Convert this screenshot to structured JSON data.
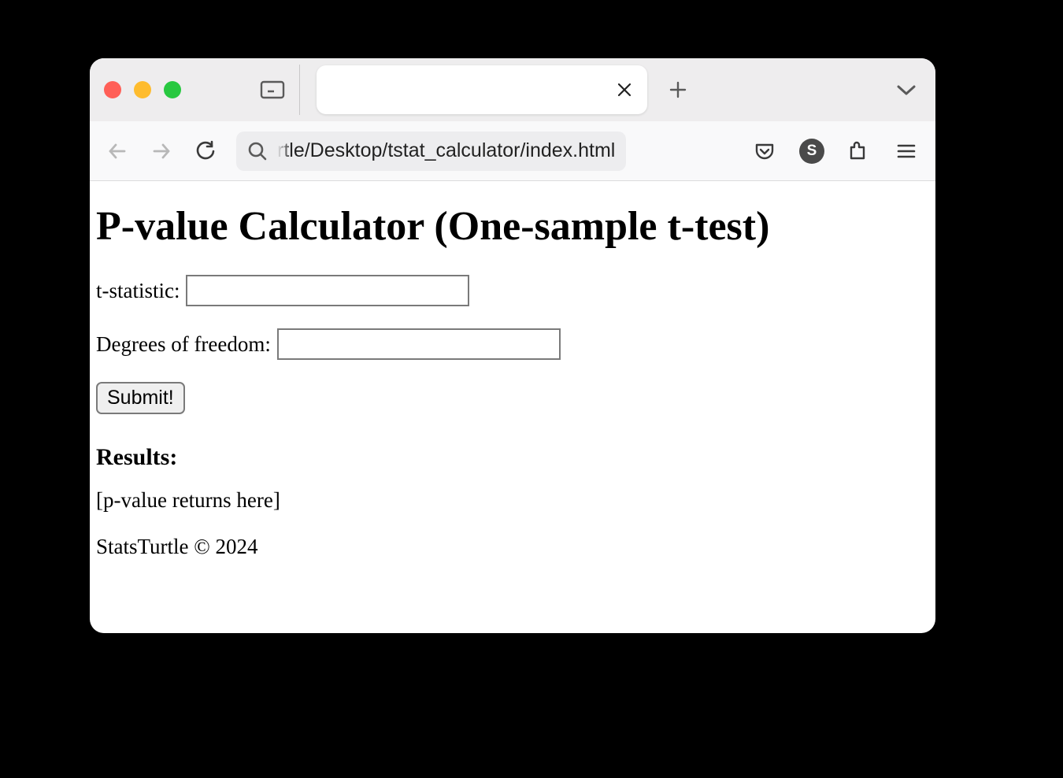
{
  "browser": {
    "url_display": "rtle/Desktop/tstat_calculator/index.html",
    "s_badge_letter": "S"
  },
  "page": {
    "heading": "P-value Calculator (One-sample t-test)",
    "labels": {
      "tstat": "t-statistic:",
      "df": "Degrees of freedom:"
    },
    "inputs": {
      "tstat_value": "",
      "df_value": ""
    },
    "submit_label": "Submit!",
    "results_heading": "Results:",
    "results_placeholder": "[p-value returns here]",
    "footer": "StatsTurtle © 2024"
  }
}
